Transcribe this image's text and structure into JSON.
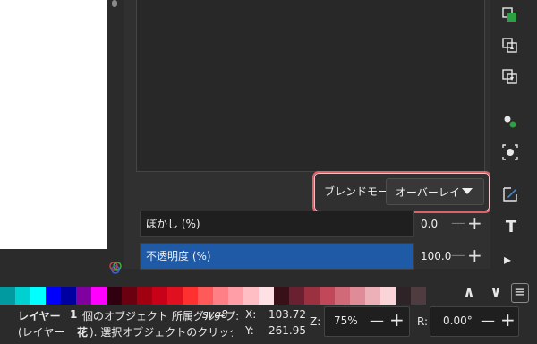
{
  "dialog": {
    "blend_label": "ブレンドモード:",
    "blend_value": "オーバーレイ",
    "blur_label": "ぼかし (%)",
    "blur_value": "0.0",
    "blur_fraction": 0.0,
    "opacity_label": "不透明度 (%)",
    "opacity_value": "100.0",
    "opacity_fraction": 1.0,
    "minus_glyph": "—",
    "plus_glyph": "+"
  },
  "palette": {
    "colors": [
      "#009aa0",
      "#00d0d0",
      "#00ffff",
      "#0000ff",
      "#0000a0",
      "#8000a0",
      "#ff00ff",
      "#300010",
      "#6a0010",
      "#a00010",
      "#c80018",
      "#e01020",
      "#ff3030",
      "#ff5a5a",
      "#ff7f86",
      "#ff9ea6",
      "#ffbec4",
      "#ffe0e4",
      "#3a1018",
      "#6a2030",
      "#9a3040",
      "#c04858",
      "#d06a78",
      "#e08c98",
      "#ecb0b8",
      "#fad4d8",
      "#2e2428",
      "#4e3c40"
    ]
  },
  "status": {
    "layer_prefix": "レイヤー",
    "layer_name": "1",
    "object_info": "個のオブジェクト 所属グループ:",
    "group_name": "svg8",
    "line2_prefix": "(レイヤー",
    "line2_bold": "花",
    "line2_rest": "). 選択オブジェクトのクリックで拡大…",
    "x_label": "X:",
    "x_value": "103.72",
    "y_label": "Y:",
    "y_value": "261.95",
    "zoom_label": "Z:",
    "zoom_value": "75%",
    "rotate_label": "R:",
    "rotate_value": "0.00°",
    "minus_glyph": "—",
    "plus_glyph": "+"
  },
  "toolbar": {
    "text_tool_glyph": "T",
    "expand_glyph": "▸",
    "up_glyph": "∧",
    "down_glyph": "∨",
    "menu_glyph": "≡"
  },
  "colors": {
    "accent": "#1f5aa6",
    "highlight": "#e0606a",
    "panel": "#303030"
  }
}
